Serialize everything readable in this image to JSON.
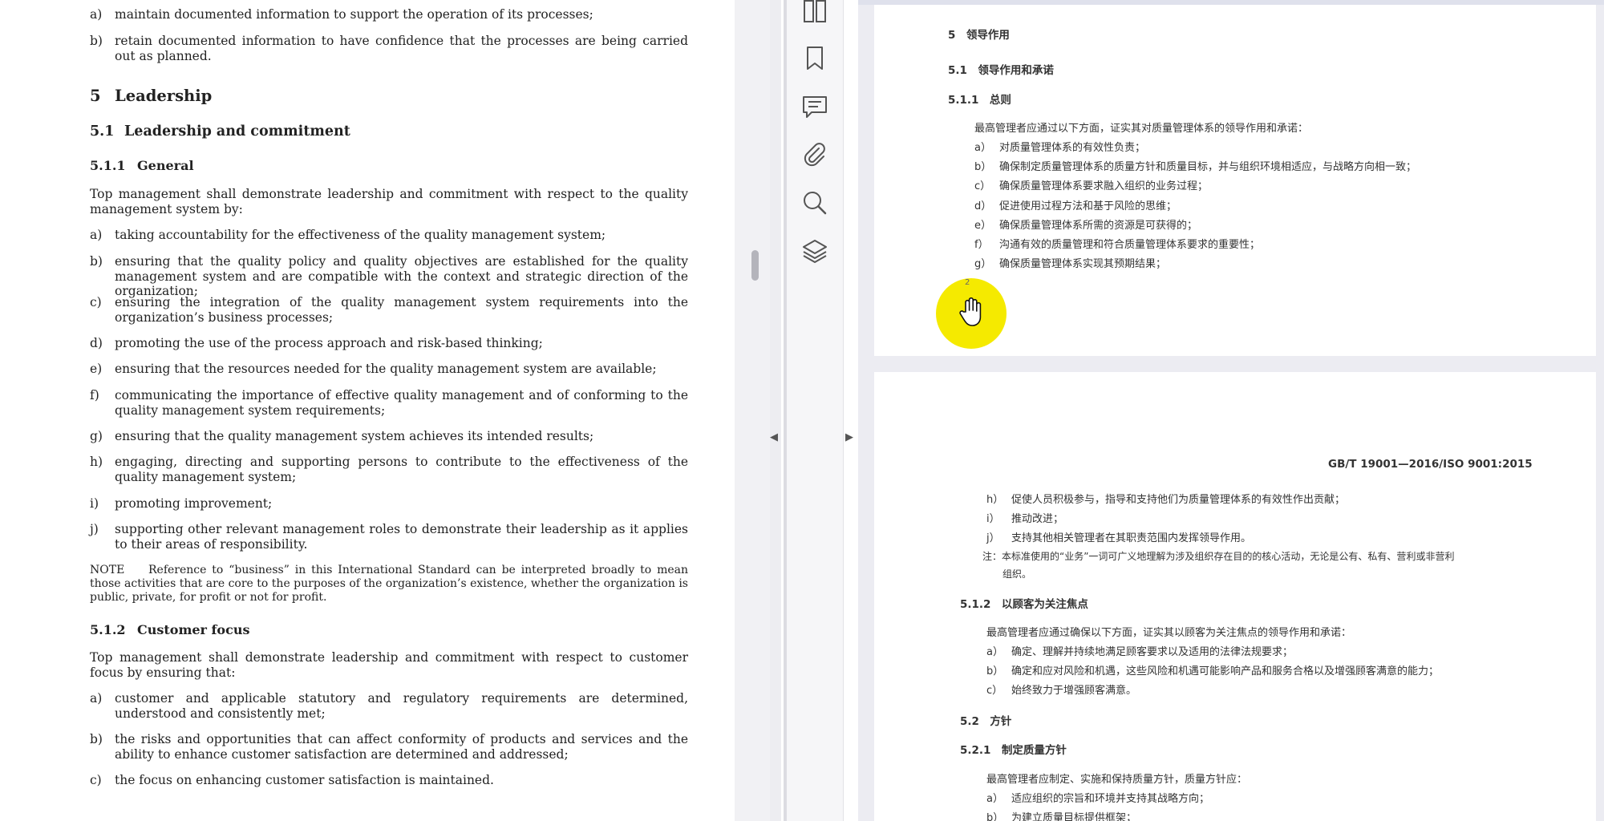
{
  "left_doc": {
    "intro_items": [
      {
        "label": "a)",
        "text": "maintain documented information to support the operation of its processes;"
      },
      {
        "label": "b)",
        "text": "retain documented information to have confidence that the processes are being carried out as planned."
      }
    ],
    "h5": {
      "num": "5",
      "title": "Leadership"
    },
    "h51": {
      "num": "5.1",
      "title": "Leadership and commitment"
    },
    "h511": {
      "num": "5.1.1",
      "title": "General"
    },
    "general_intro": "Top management shall demonstrate leadership and commitment with respect to the quality management system by:",
    "general_items": [
      {
        "label": "a)",
        "text": "taking accountability for the effectiveness of the quality management system;"
      },
      {
        "label": "b)",
        "text": "ensuring that the quality policy and quality objectives are established for the quality management system and are compatible with the context and strategic direction of the organization;"
      },
      {
        "label": "c)",
        "text": "ensuring the integration of the quality management system requirements into the organization’s business processes;"
      },
      {
        "label": "d)",
        "text": "promoting the use of the process approach and risk-based thinking;"
      },
      {
        "label": "e)",
        "text": "ensuring that the resources needed for the quality management system are available;"
      },
      {
        "label": "f)",
        "text": "communicating the importance of effective quality management and of conforming to the quality management system requirements;"
      },
      {
        "label": "g)",
        "text": "ensuring that the quality management system achieves its intended results;"
      },
      {
        "label": "h)",
        "text": "engaging, directing and supporting persons to contribute to the effectiveness of the quality management system;"
      },
      {
        "label": "i)",
        "text": "promoting improvement;"
      },
      {
        "label": "j)",
        "text": "supporting other relevant management roles to demonstrate their leadership as it applies to their areas of responsibility."
      }
    ],
    "note_label": "NOTE",
    "note_text": "Reference to “business” in this International Standard can be interpreted broadly to mean those activities that are core to the purposes of the organization’s existence, whether the organization is public, private, for profit or not for profit.",
    "h512": {
      "num": "5.1.2",
      "title": "Customer focus"
    },
    "customer_intro": "Top management shall demonstrate leadership and commitment with respect to customer focus by ensuring that:",
    "customer_items": [
      {
        "label": "a)",
        "text": "customer and applicable statutory and regulatory requirements are determined, understood and consistently met;"
      },
      {
        "label": "b)",
        "text": "the risks and opportunities that can affect conformity of products and services and the ability to enhance customer satisfaction are determined and addressed;"
      },
      {
        "label": "c)",
        "text": "the focus on enhancing customer satisfaction is maintained."
      }
    ]
  },
  "toolbar": {
    "icons": [
      "page-layout-icon",
      "bookmark-icon",
      "comment-icon",
      "attachment-icon",
      "search-icon",
      "layers-icon"
    ]
  },
  "right_doc": {
    "page1": {
      "h5": "5　领导作用",
      "h51": "5.1　领导作用和承诺",
      "h511": "5.1.1　总则",
      "intro": "最高管理者应通过以下方面，证实其对质量管理体系的领导作用和承诺：",
      "items": [
        {
          "label": "a）",
          "text": "对质量管理体系的有效性负责；"
        },
        {
          "label": "b）",
          "text": "确保制定质量管理体系的质量方针和质量目标，并与组织环境相适应，与战略方向相一致；"
        },
        {
          "label": "c）",
          "text": "确保质量管理体系要求融入组织的业务过程；"
        },
        {
          "label": "d）",
          "text": "促进使用过程方法和基于风险的思维；"
        },
        {
          "label": "e）",
          "text": "确保质量管理体系所需的资源是可获得的；"
        },
        {
          "label": "f）",
          "text": "沟通有效的质量管理和符合质量管理体系要求的重要性；"
        },
        {
          "label": "g）",
          "text": "确保质量管理体系实现其预期结果；"
        }
      ],
      "page_number": "2"
    },
    "page2": {
      "header": "GB/T 19001—2016/ISO 9001:2015",
      "items": [
        {
          "label": "h）",
          "text": "促使人员积极参与，指导和支持他们为质量管理体系的有效性作出贡献；"
        },
        {
          "label": "i）",
          "text": "推动改进；"
        },
        {
          "label": "j）",
          "text": "支持其他相关管理者在其职责范围内发挥领导作用。"
        }
      ],
      "note_line1": "注：本标准使用的“业务”一词可广义地理解为涉及组织存在目的的核心活动，无论是公有、私有、营利或非营利",
      "note_line2": "组织。",
      "h512": "5.1.2　以顾客为关注焦点",
      "customer_intro": "最高管理者应通过确保以下方面，证实其以顾客为关注焦点的领导作用和承诺：",
      "customer_items": [
        {
          "label": "a）",
          "text": "确定、理解并持续地满足顾客要求以及适用的法律法规要求；"
        },
        {
          "label": "b）",
          "text": "确定和应对风险和机遇，这些风险和机遇可能影响产品和服务合格以及增强顾客满意的能力；"
        },
        {
          "label": "c）",
          "text": "始终致力于增强顾客满意。"
        }
      ],
      "h52": "5.2　方针",
      "h521": "5.2.1　制定质量方针",
      "policy_intro": "最高管理者应制定、实施和保持质量方针，质量方针应：",
      "policy_items": [
        {
          "label": "a）",
          "text": "适应组织的宗旨和环境并支持其战略方向；"
        },
        {
          "label": "b）",
          "text": "为建立质量目标提供框架；"
        }
      ]
    }
  },
  "colors": {
    "cursor_highlight": "#f5ea00",
    "pane_bg": "#ececf2"
  }
}
